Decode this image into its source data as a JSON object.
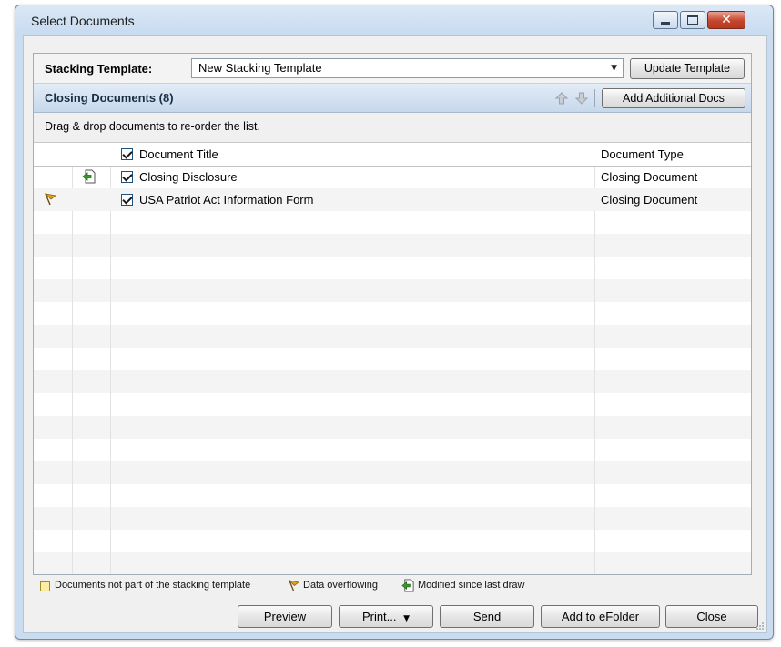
{
  "window": {
    "title": "Select Documents",
    "controls": {
      "minimize": "minimize-icon",
      "maximize": "maximize-icon",
      "close": "close-icon"
    }
  },
  "stacking": {
    "label": "Stacking Template:",
    "selected": "New Stacking Template",
    "update_button": "Update Template"
  },
  "closing": {
    "title": "Closing Documents (8)",
    "add_button": "Add Additional Docs"
  },
  "hint": "Drag & drop documents to re-order the list.",
  "table": {
    "headers": {
      "title": "Document Title",
      "type": "Document Type"
    },
    "rows": [
      {
        "title": "Closing Disclosure",
        "type": "Closing Document",
        "checked": true,
        "icon": "modified-icon"
      },
      {
        "title": "USA Patriot Act Information Form",
        "type": "Closing Document",
        "checked": true,
        "icon": "data-overflow-flag-icon"
      }
    ]
  },
  "legend": {
    "not_in_template": "Documents not part of the stacking template",
    "overflowing": "Data overflowing",
    "modified": "Modified since last draw"
  },
  "buttons": {
    "preview": "Preview",
    "print": "Print...",
    "send": "Send",
    "add_efolder": "Add to eFolder",
    "close": "Close"
  },
  "colors": {
    "accent": "#c7d8ec",
    "legend_yellow": "#fbeea3",
    "flag": "#e0a020"
  }
}
